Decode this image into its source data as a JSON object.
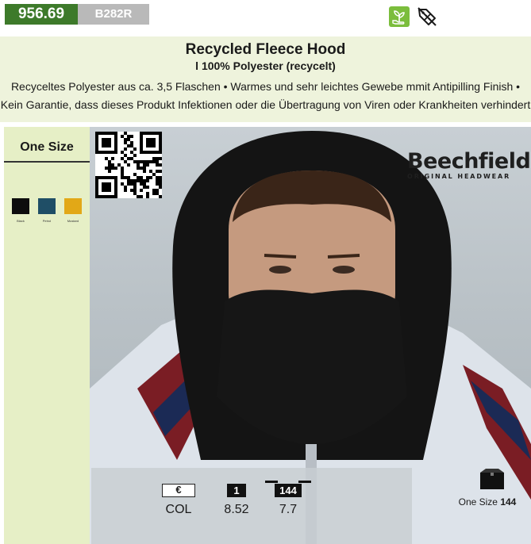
{
  "header": {
    "price_code": "956.69",
    "article_code": "B282R",
    "icons": [
      "eco-plant-icon",
      "discount-tag-icon"
    ]
  },
  "product": {
    "title": "Recycled Fleece Hood",
    "subtitle": "l 100% Polyester (recycelt)",
    "description_line1": "Recyceltes Polyester aus ca. 3,5 Flaschen • Warmes und sehr leichtes Gewebe mmit Antipilling Finish •",
    "description_line2": "Kein Garantie, dass dieses Produkt Infektionen oder die Übertragung von Viren oder Krankheiten verhindert"
  },
  "sidebar": {
    "size_label": "One Size",
    "colors": [
      {
        "name": "Black",
        "hex": "#0d0d0d"
      },
      {
        "name": "Petrol",
        "hex": "#1f4e66"
      },
      {
        "name": "Mustard",
        "hex": "#e2a817"
      }
    ]
  },
  "brand": {
    "name": "Beechfield",
    "tagline": "ORIGINAL HEADWEAR"
  },
  "pricing": {
    "currency_label": "€",
    "col_label": "COL",
    "qty1_label": "1",
    "qty1_price": "8.52",
    "carton_label": "144",
    "carton_price": "7.7"
  },
  "packaging": {
    "size_text": "One Size",
    "qty": "144"
  },
  "colors": {
    "brand_green": "#3d7a2a",
    "code_grey": "#b9b9b9",
    "band_bg": "#eef3dc",
    "sidebar_bg": "#e6efc6"
  }
}
